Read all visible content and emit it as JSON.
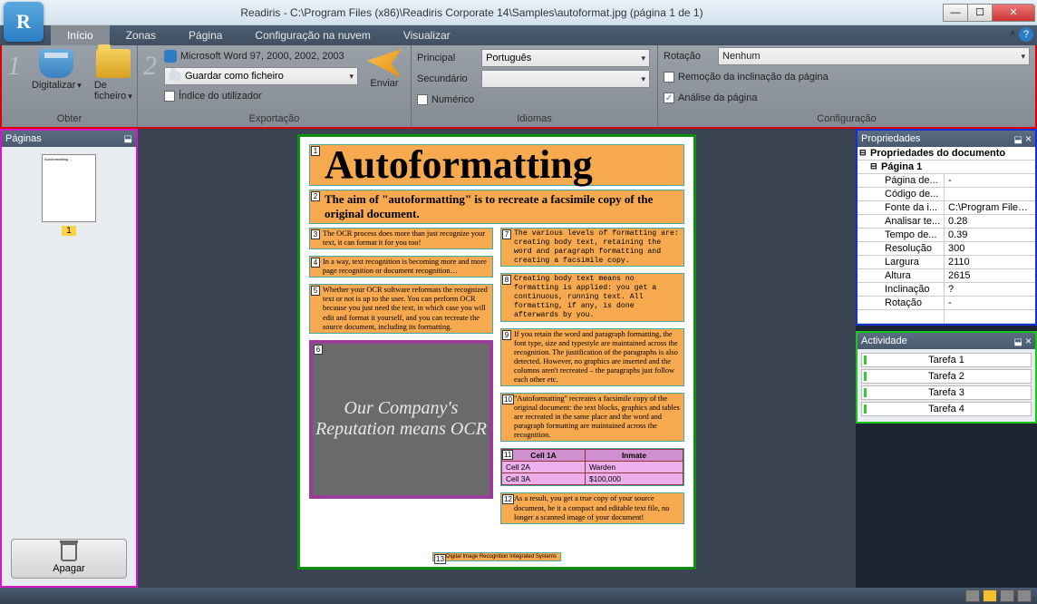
{
  "title": "Readiris - C:\\Program Files (x86)\\Readiris Corporate 14\\Samples\\autoformat.jpg (página 1 de 1)",
  "menu": {
    "tabs": [
      "Início",
      "Zonas",
      "Página",
      "Configuração na nuvem",
      "Visualizar"
    ],
    "active": 0
  },
  "ribbon": {
    "obter": {
      "title": "Obter",
      "digitalizar": "Digitalizar",
      "ficheiro": "De ficheiro"
    },
    "export": {
      "title": "Exportação",
      "format": "Microsoft Word 97, 2000, 2002, 2003",
      "saveas": "Guardar como ficheiro",
      "index": "Índice do utilizador",
      "send": "Enviar"
    },
    "lang": {
      "title": "Idiomas",
      "principal_lbl": "Principal",
      "principal": "Português",
      "sec_lbl": "Secundário",
      "sec": "",
      "num": "Numérico"
    },
    "config": {
      "title": "Configuração",
      "rot_lbl": "Rotação",
      "rot": "Nenhum",
      "deskew": "Remoção da inclinação da página",
      "analysis": "Análise da página",
      "analysis_on": true
    }
  },
  "pages_panel": {
    "title": "Páginas",
    "page_num": "1",
    "delete": "Apagar"
  },
  "doc": {
    "h1": "Autoformatting",
    "h2": "The aim of \"autoformatting\" is to recreate a facsimile copy of the original document.",
    "left": [
      "The OCR process does more than just recognize your text, it can format it for you too!",
      "In a way, text recognition is becoming more and more page recognition or document recognition…",
      "Whether your OCR software reformats the recognized text or not is up to the user. You can perform OCR because you just need the text, in which case you will edit and format it yourself, and you can recreate the source document, including its formatting."
    ],
    "img_text": "Our Company's Reputation means OCR",
    "right": [
      "The various levels of formatting are: creating body text, retaining the word and paragraph formatting and creating a facsimile copy.",
      "Creating body text means no formatting is applied: you get a continuous, running text. All formatting, if any, is done afterwards by you.",
      "If you retain the word and paragraph formatting, the font type, size and typestyle are maintained across the recognition. The justification of the paragraphs is also detected. However, no graphics are inserted and the columns aren't recreated – the paragraphs just follow each other etc.",
      "\"Autoformatting\" recreates a facsimile copy of the original document: the text blocks, graphics and tables are recreated in the same place and the word and paragraph formatting are maintained across the recognition.",
      "As a result, you get a true copy of your source document, be it a compact and editable text file, no longer a scanned image of your document!"
    ],
    "table": [
      [
        "Cell 1A",
        "Inmate"
      ],
      [
        "Cell 2A",
        "Warden"
      ],
      [
        "Cell 3A",
        "$100,000"
      ]
    ],
    "footer": "Digital Image Recognition Integrated Systems"
  },
  "props": {
    "title": "Propriedades",
    "root": "Propriedades do documento",
    "page": "Página 1",
    "rows": [
      {
        "k": "Página de...",
        "v": "-"
      },
      {
        "k": "Código de...",
        "v": ""
      },
      {
        "k": "Fonte da i...",
        "v": "C:\\Program Files ..."
      },
      {
        "k": "Analisar te...",
        "v": "0.28"
      },
      {
        "k": "Tempo de...",
        "v": "0.39"
      },
      {
        "k": "Resolução",
        "v": "300"
      },
      {
        "k": "Largura",
        "v": "2110"
      },
      {
        "k": "Altura",
        "v": "2615"
      },
      {
        "k": "Inclinação",
        "v": "?"
      },
      {
        "k": "Rotação",
        "v": "-"
      }
    ]
  },
  "activity": {
    "title": "Actividade",
    "tasks": [
      "Tarefa 1",
      "Tarefa 2",
      "Tarefa 3",
      "Tarefa 4"
    ]
  }
}
